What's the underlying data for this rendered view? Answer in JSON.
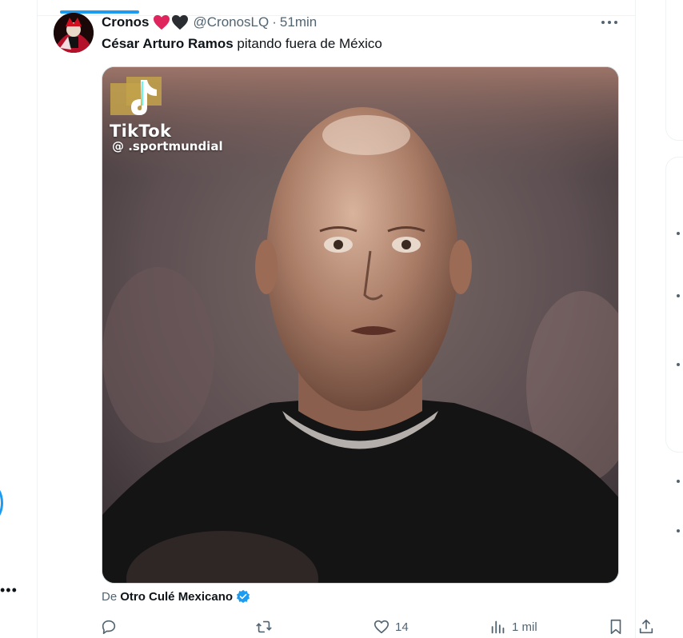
{
  "tweet": {
    "author_name": "Cronos",
    "author_handle": "@CronosLQ",
    "separator": "·",
    "time": "51min",
    "text_bold": "César Arturo Ramos",
    "text_rest": " pitando fuera de México",
    "attribution_prefix": "De",
    "attribution_name": "Otro Culé Mexicano",
    "stats": {
      "likes": "14",
      "views": "1 mil"
    }
  },
  "media": {
    "watermark_brand": "TikTok",
    "watermark_user": "@ .sportmundial"
  },
  "left_nav": {
    "more_glyph": "•••"
  },
  "colors": {
    "accent": "#1d9bf0",
    "heart_red": "#f91880",
    "heart_black": "#2a2d31",
    "text_primary": "#0f1419",
    "text_secondary": "#536471"
  },
  "icons": [
    "reply-icon",
    "retweet-icon",
    "like-icon",
    "views-icon",
    "bookmark-icon",
    "share-icon",
    "verified-icon",
    "more-icon"
  ]
}
